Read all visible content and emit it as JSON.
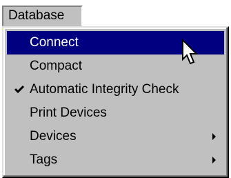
{
  "menubar": {
    "title": "Database"
  },
  "menu": {
    "items": [
      {
        "label": "Connect",
        "checked": false,
        "submenu": false,
        "highlighted": true
      },
      {
        "label": "Compact",
        "checked": false,
        "submenu": false,
        "highlighted": false
      },
      {
        "label": "Automatic Integrity Check",
        "checked": true,
        "submenu": false,
        "highlighted": false
      },
      {
        "label": "Print Devices",
        "checked": false,
        "submenu": false,
        "highlighted": false
      },
      {
        "label": "Devices",
        "checked": false,
        "submenu": true,
        "highlighted": false
      },
      {
        "label": "Tags",
        "checked": false,
        "submenu": true,
        "highlighted": false
      }
    ]
  },
  "colors": {
    "menu_background": "#c0c0c0",
    "highlight_background": "#000080",
    "highlight_text": "#ffffff"
  },
  "icons": {
    "check": "check-icon",
    "submenu_arrow": "submenu-arrow-icon",
    "cursor": "mouse-pointer-icon"
  }
}
